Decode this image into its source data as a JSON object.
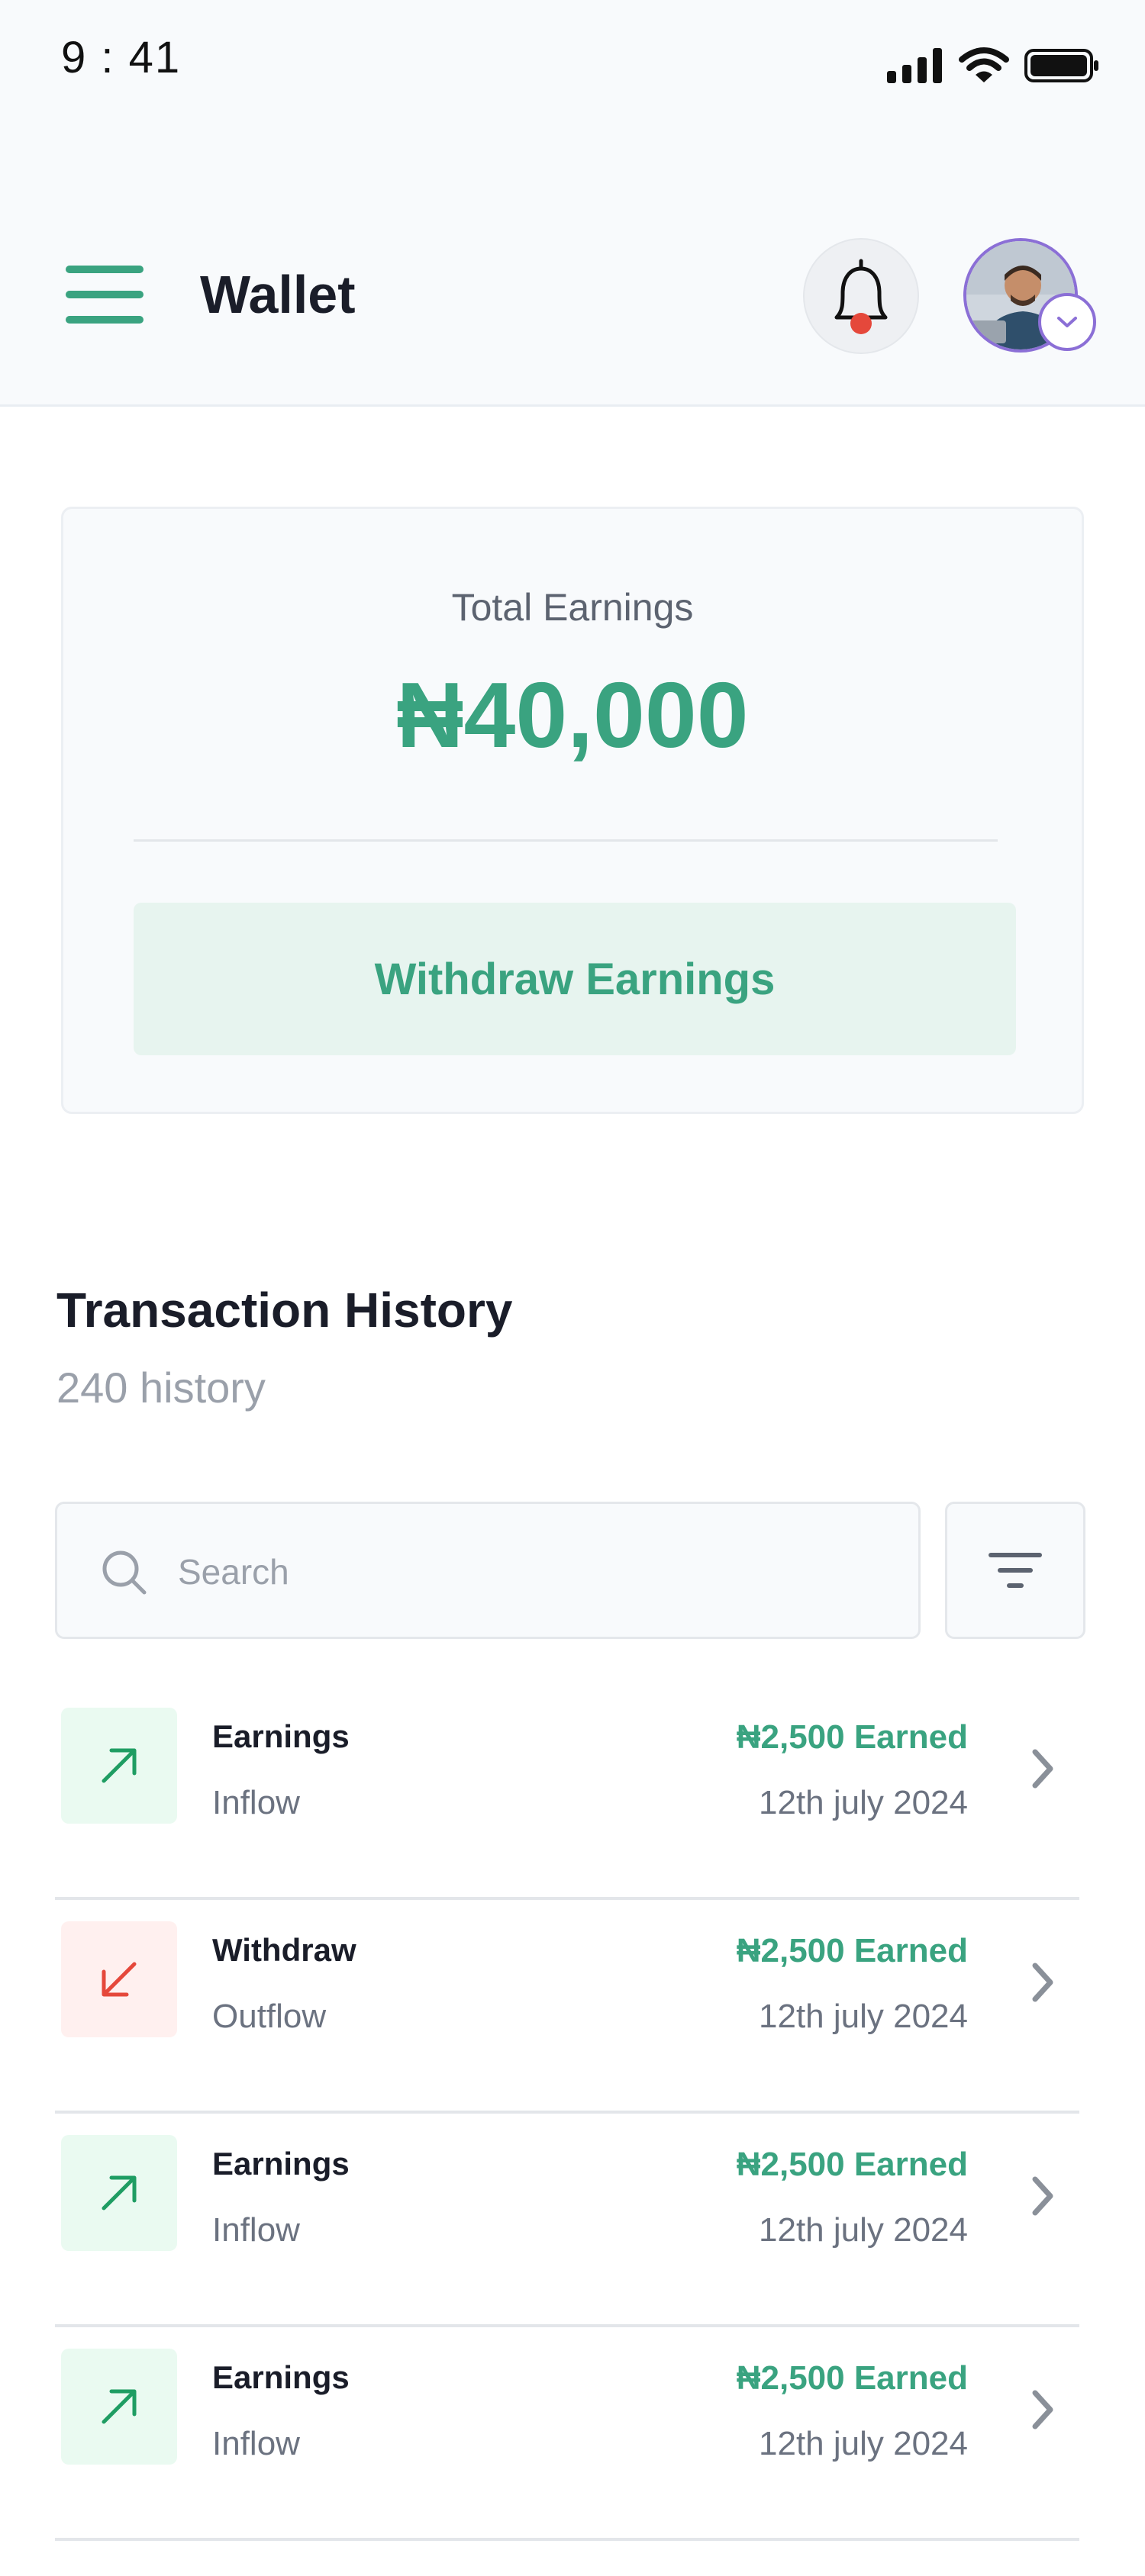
{
  "status_bar": {
    "time": "9 : 41"
  },
  "header": {
    "title": "Wallet",
    "menu_icon": "hamburger-menu-icon",
    "notification_icon": "bell-icon",
    "avatar_dropdown_icon": "chevron-down-icon"
  },
  "earnings_card": {
    "label": "Total Earnings",
    "amount": "₦40,000",
    "withdraw_label": "Withdraw Earnings"
  },
  "transactions": {
    "title": "Transaction History",
    "count_label": "240 history",
    "search": {
      "placeholder": "Search",
      "value": ""
    },
    "items": [
      {
        "name": "Earnings",
        "type": "Inflow",
        "amount": "₦2,500 Earned",
        "date": "12th july 2024",
        "direction": "in"
      },
      {
        "name": "Withdraw",
        "type": "Outflow",
        "amount": "₦2,500 Earned",
        "date": "12th july 2024",
        "direction": "out"
      },
      {
        "name": "Earnings",
        "type": "Inflow",
        "amount": "₦2,500 Earned",
        "date": "12th july 2024",
        "direction": "in"
      },
      {
        "name": "Earnings",
        "type": "Inflow",
        "amount": "₦2,500 Earned",
        "date": "12th july 2024",
        "direction": "in"
      }
    ]
  },
  "colors": {
    "accent": "#3aa380",
    "accent_light": "#e7f4ef",
    "danger": "#e5483b",
    "notification_dot": "#e5483b",
    "avatar_ring": "#8b6fd6"
  }
}
